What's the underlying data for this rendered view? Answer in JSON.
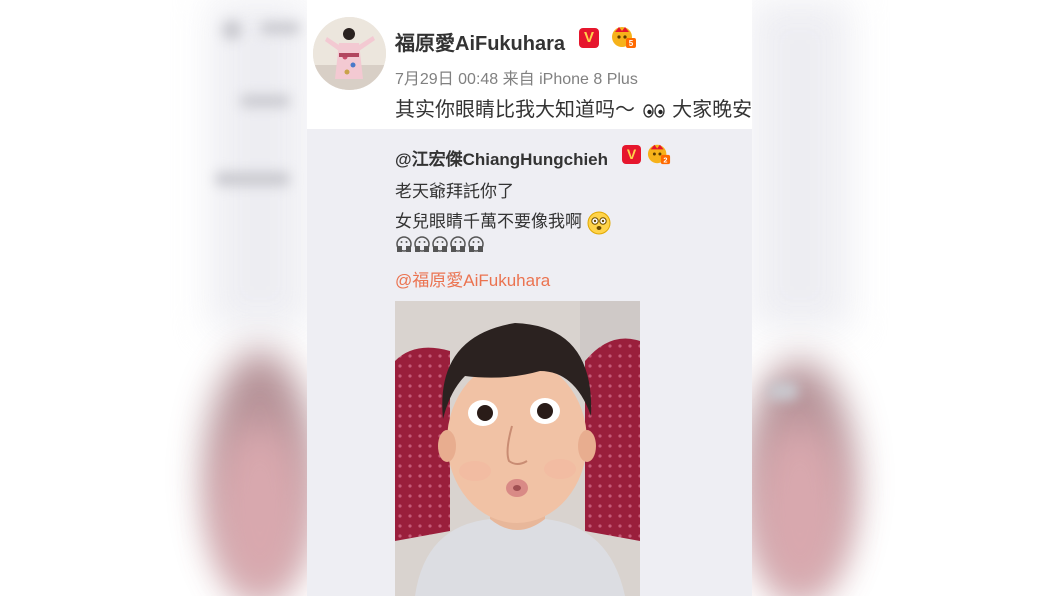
{
  "post": {
    "username": "福原愛AiFukuhara",
    "verified_label": "V",
    "level_badge_icon": "member-level-icon",
    "timestamp": "7月29日 00:48",
    "source": "来自 iPhone 8 Plus",
    "text_main": "其实你眼睛比我大知道吗～",
    "text_tail": "大家晚安"
  },
  "repost": {
    "username": "@江宏傑ChiangHungchieh",
    "verified_label": "V",
    "line1": "老天爺拜託你了",
    "line2": "女兒眼睛千萬不要像我啊",
    "mention": "@福原愛AiFukuhara",
    "photo_icon": "selfie-photo"
  },
  "colors": {
    "mention": "#eb7350",
    "verified": "#e6162d",
    "repost_bg": "#eeeef3"
  }
}
